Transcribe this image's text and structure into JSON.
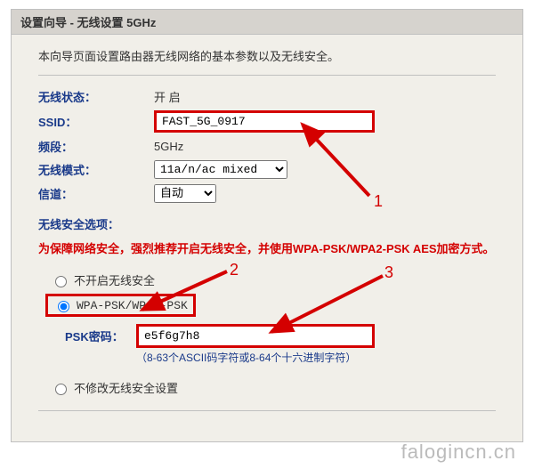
{
  "title": "设置向导 - 无线设置 5GHz",
  "intro": "本向导页面设置路由器无线网络的基本参数以及无线安全。",
  "fields": {
    "status_label": "无线状态：",
    "status_value": "开 启",
    "ssid_label": "SSID：",
    "ssid_value": "FAST_5G_0917",
    "band_label": "频段：",
    "band_value": "5GHz",
    "mode_label": "无线模式：",
    "mode_value": "11a/n/ac mixed",
    "channel_label": "信道：",
    "channel_value": "自动"
  },
  "security": {
    "heading": "无线安全选项：",
    "warning": "为保障网络安全，强烈推荐开启无线安全，并使用WPA-PSK/WPA2-PSK AES加密方式。",
    "opt_none": "不开启无线安全",
    "opt_wpa": "WPA-PSK/WPA2-PSK",
    "opt_keep": "不修改无线安全设置",
    "psk_label": "PSK密码：",
    "psk_value": "e5f6g7h8",
    "psk_hint": "（8-63个ASCII码字符或8-64个十六进制字符）"
  },
  "annotations": {
    "n1": "1",
    "n2": "2",
    "n3": "3"
  },
  "watermark": "falogincn.cn"
}
